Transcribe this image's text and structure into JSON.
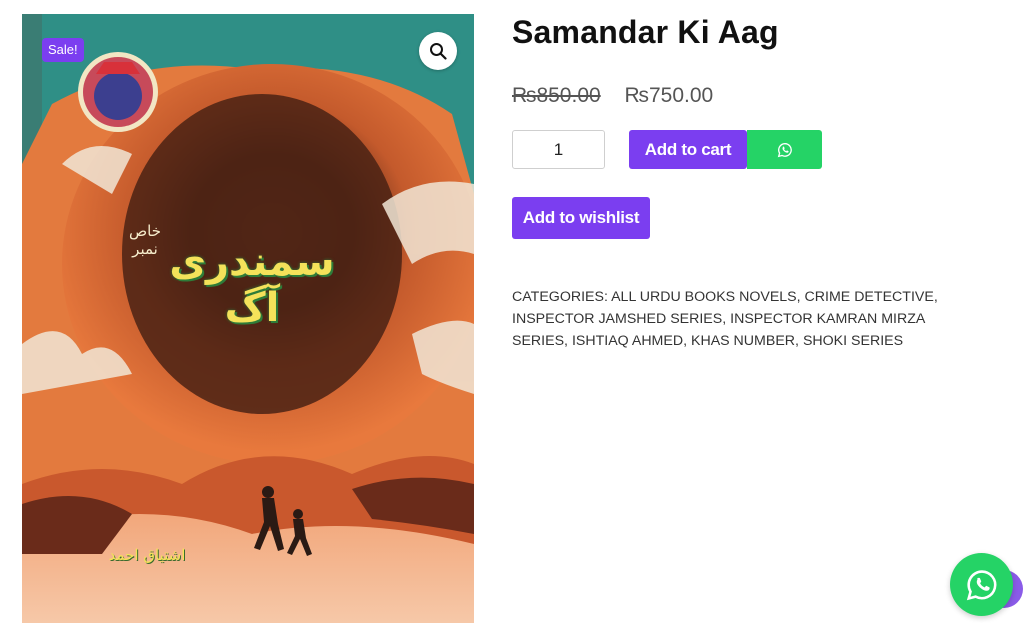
{
  "product": {
    "title": "Samandar Ki Aag",
    "sale_badge": "Sale!",
    "price_old": "₨850.00",
    "price_new": "₨750.00",
    "quantity": "1",
    "cover": {
      "title_urdu": "سمندری آگ",
      "subtitle_urdu": "خاص نمبر",
      "author_urdu": "اشتیاق احمد"
    }
  },
  "actions": {
    "add_to_cart": "Add to cart",
    "add_to_wishlist": "Add to wishlist"
  },
  "categories": {
    "label": "CATEGORIES:",
    "items": [
      "ALL URDU BOOKS NOVELS",
      "CRIME DETECTIVE",
      "INSPECTOR JAMSHED SERIES",
      "INSPECTOR KAMRAN MIRZA SERIES",
      "ISHTIAQ AHMED",
      "KHAS NUMBER",
      "SHOKI SERIES"
    ]
  },
  "icons": {
    "zoom": "search-icon",
    "whatsapp": "whatsapp-icon"
  },
  "colors": {
    "accent": "#7b3ef0",
    "whatsapp": "#25d366",
    "cover_sky": "#2f8f86",
    "cover_fire": "#d9632f"
  }
}
